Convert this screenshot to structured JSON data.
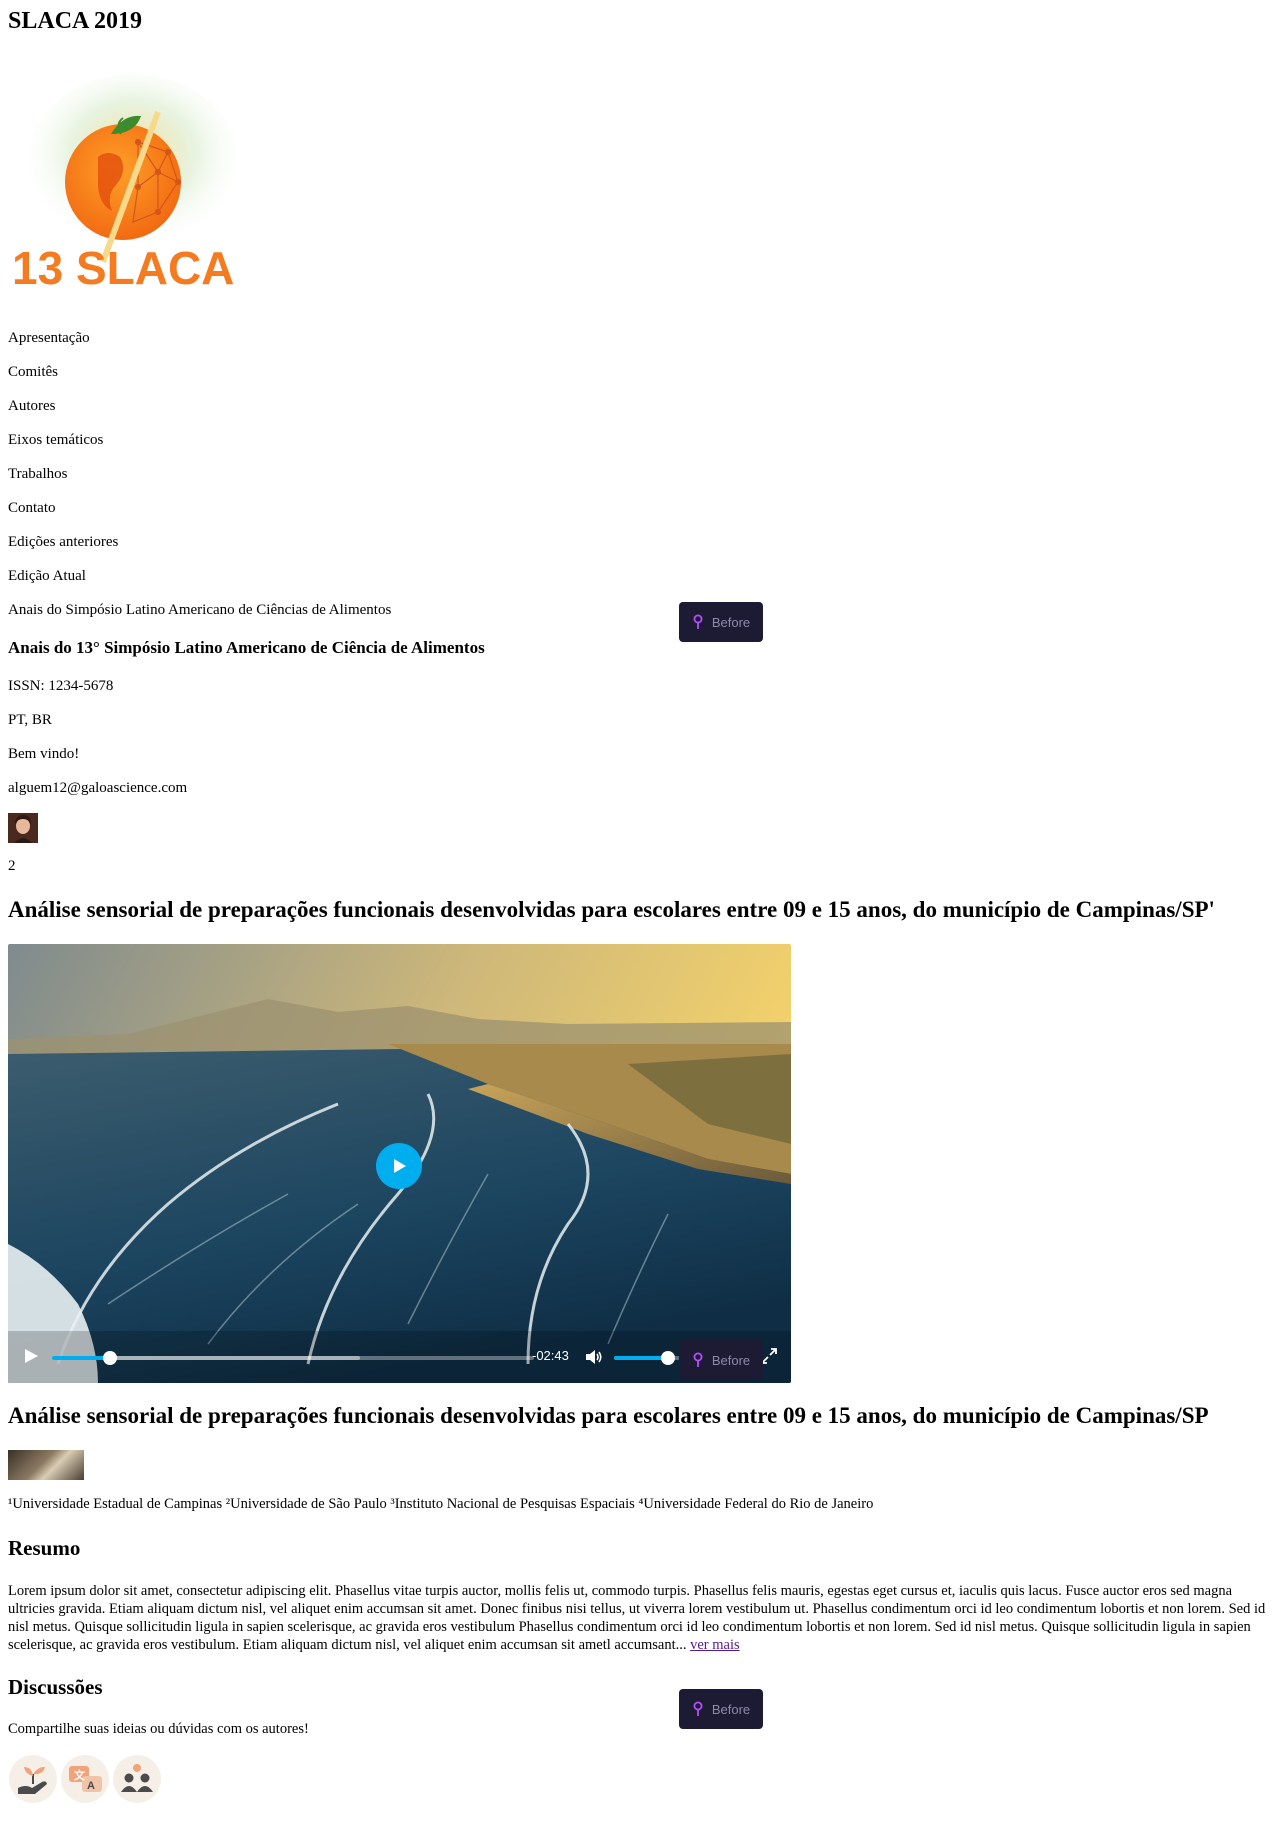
{
  "site_title": "SLACA 2019",
  "logo": {
    "text": "13 SLACA"
  },
  "nav": [
    "Apresentação",
    "Comitês",
    "Autores",
    "Eixos temáticos",
    "Trabalhos",
    "Contato",
    "Edições anteriores",
    "Edição Atual",
    "Anais do Simpósio Latino Americano de Ciências de Alimentos"
  ],
  "info": {
    "title": "Anais do 13° Simpósio Latino Americano de Ciência de Alimentos",
    "issn": "ISSN: 1234-5678",
    "language": "PT, BR",
    "welcome": "Bem vindo!",
    "email": "alguem12@galoascience.com",
    "count": "2"
  },
  "paper": {
    "title_top": "Análise sensorial de preparações funcionais desenvolvidas para escolares entre 09 e 15 anos, do município de Campinas/SP'",
    "title": "Análise sensorial de preparações funcionais desenvolvidas para escolares entre 09 e 15 anos, do município de Campinas/SP",
    "affiliations": "¹Universidade Estadual de Campinas ²Universidade de São Paulo ³Instituto Nacional de Pesquisas Espaciais ⁴Universidade Federal do Rio de Janeiro"
  },
  "video": {
    "time_remaining": "-02:43",
    "progress_fraction": 0.12,
    "buffered_fraction": 0.64,
    "volume_fraction": 0.82
  },
  "before_label": "Before",
  "abstract": {
    "heading": "Resumo",
    "text": "Lorem ipsum dolor sit amet, consectetur adipiscing elit. Phasellus vitae turpis auctor, mollis felis ut, commodo turpis. Phasellus felis mauris, egestas eget cursus et, iaculis quis lacus. Fusce auctor eros sed magna ultricies gravida. Etiam aliquam dictum nisl, vel aliquet enim accumsan sit amet. Donec finibus nisi tellus, ut viverra lorem vestibulum ut. Phasellus condimentum orci id leo condimentum lobortis et non lorem. Sed id nisl metus. Quisque sollicitudin ligula in sapien scelerisque, ac gravida eros vestibulum Phasellus condimentum orci id leo condimentum lobortis et non lorem. Sed id nisl metus. Quisque sollicitudin ligula in sapien scelerisque, ac gravida eros vestibulum. Etiam aliquam dictum nisl, vel aliquet enim accumsan sit ametl accumsant...",
    "more_link": "ver mais"
  },
  "discussions": {
    "heading": "Discussões",
    "subtitle": "Compartilhe suas ideias ou dúvidas com os autores!"
  },
  "colors": {
    "accent": "#00adef",
    "before_bg": "#1c1b33",
    "before_text": "#8c8aa8",
    "before_pin": "#b44dff",
    "logo_orange": "#f47b20",
    "link_visited": "#551a8b"
  }
}
